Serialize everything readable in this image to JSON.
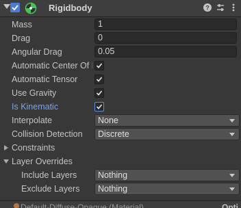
{
  "component": {
    "title": "Rigidbody",
    "enabled": true,
    "help_icon": "help-icon",
    "preset_icon": "sliders-icon",
    "menu_icon": "more-vertical-icon"
  },
  "fields": {
    "mass": {
      "label": "Mass",
      "value": "1"
    },
    "drag": {
      "label": "Drag",
      "value": "0"
    },
    "angular_drag": {
      "label": "Angular Drag",
      "value": "0.05"
    },
    "auto_com": {
      "label": "Automatic Center Of Mass",
      "checked": true
    },
    "auto_tensor": {
      "label": "Automatic Tensor",
      "checked": true
    },
    "use_gravity": {
      "label": "Use Gravity",
      "checked": true
    },
    "is_kinematic": {
      "label": "Is Kinematic",
      "checked": true
    },
    "interpolate": {
      "label": "Interpolate",
      "value": "None"
    },
    "collision_detection": {
      "label": "Collision Detection",
      "value": "Discrete"
    },
    "constraints": {
      "label": "Constraints"
    },
    "layer_overrides": {
      "label": "Layer Overrides"
    },
    "include_layers": {
      "label": "Include Layers",
      "value": "Nothing"
    },
    "exclude_layers": {
      "label": "Exclude Layers",
      "value": "Nothing"
    }
  },
  "footer": {
    "text": "Default-Diffuse-Opaque (Material)",
    "right": "Opti"
  },
  "colors": {
    "background": "#383838",
    "accent_blue": "#7ba5e8",
    "field_bg": "#2a2a2a",
    "dropdown_bg": "#515151"
  }
}
